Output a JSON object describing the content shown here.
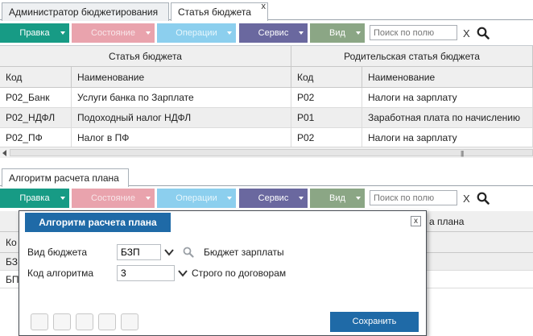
{
  "tabs_top": [
    {
      "label": "Администратор бюджетирования"
    },
    {
      "label": "Статья бюджета",
      "close": "x"
    }
  ],
  "toolbar_top": {
    "edit": "Правка",
    "state": "Состояние",
    "operations": "Операции",
    "service": "Сервис",
    "view": "Вид",
    "search_placeholder": "Поиск по полю",
    "clear": "X"
  },
  "grid": {
    "group_left": "Статья бюджета",
    "group_right": "Родительская статья бюджета",
    "columns": [
      "Код",
      "Наименование",
      "Код",
      "Наименование"
    ],
    "rows": [
      [
        "Р02_Банк",
        "Услуги банка по Зарплате",
        "Р02",
        "Налоги на зарплату"
      ],
      [
        "Р02_НДФЛ",
        "Подоходный налог НДФЛ",
        "Р01",
        "Заработная плата по начислению"
      ],
      [
        "Р02_ПФ",
        "Налог в ПФ",
        "Р02",
        "Налоги на зарплату"
      ]
    ],
    "scroll_grip": "|||"
  },
  "tabs_bottom": [
    {
      "label": "Алгоритм расчета плана"
    }
  ],
  "toolbar_bottom": {
    "edit": "Правка",
    "state": "Состояние",
    "operations": "Операции",
    "service": "Сервис",
    "view": "Вид",
    "search_placeholder": "Поиск по полю",
    "clear": "X"
  },
  "grid2": {
    "header_partial": "а плана",
    "col_partial": "Ко",
    "row1_partial": "БЗ",
    "row2_partial": "БП"
  },
  "modal": {
    "title": "Алгоритм расчета плана",
    "close": "x",
    "budget_type_label": "Вид бюджета",
    "budget_type_value": "БЗП",
    "budget_type_name": "Бюджет зарплаты",
    "algo_code_label": "Код алгоритма",
    "algo_code_value": "3",
    "algo_name": "Строго по договорам",
    "save": "Сохранить"
  },
  "colors": {
    "edit": "#179b85",
    "state": "#e9a3ad",
    "operations": "#8ccfee",
    "service": "#6a689f",
    "view": "#8ba685",
    "accent": "#1f6aa7"
  }
}
